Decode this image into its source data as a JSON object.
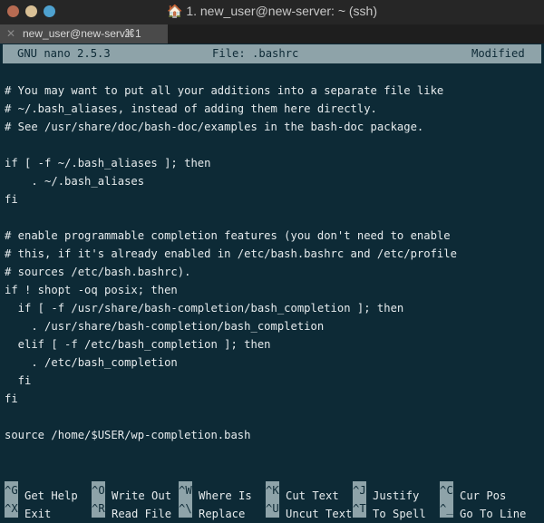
{
  "window": {
    "title": "1. new_user@new-server: ~ (ssh)",
    "icon": "home-icon",
    "traffic_lights": {
      "close": "#b76b52",
      "minimize": "#d9c095",
      "zoom": "#4ea1cf"
    }
  },
  "tab": {
    "label": "new_user@new-serv...",
    "shortcut": "⌘1"
  },
  "nano": {
    "version": "GNU nano 2.5.3",
    "file": "File: .bashrc",
    "status": "Modified"
  },
  "lines": [
    "# You may want to put all your additions into a separate file like",
    "# ~/.bash_aliases, instead of adding them here directly.",
    "# See /usr/share/doc/bash-doc/examples in the bash-doc package.",
    "",
    "if [ -f ~/.bash_aliases ]; then",
    "    . ~/.bash_aliases",
    "fi",
    "",
    "# enable programmable completion features (you don't need to enable",
    "# this, if it's already enabled in /etc/bash.bashrc and /etc/profile",
    "# sources /etc/bash.bashrc).",
    "if ! shopt -oq posix; then",
    "  if [ -f /usr/share/bash-completion/bash_completion ]; then",
    "    . /usr/share/bash-completion/bash_completion",
    "  elif [ -f /etc/bash_completion ]; then",
    "    . /etc/bash_completion",
    "  fi",
    "fi",
    "",
    "source /home/$USER/wp-completion.bash"
  ],
  "shortcuts": [
    [
      {
        "key": "^G",
        "label": "Get Help"
      },
      {
        "key": "^O",
        "label": "Write Out"
      },
      {
        "key": "^W",
        "label": "Where Is"
      },
      {
        "key": "^K",
        "label": "Cut Text"
      },
      {
        "key": "^J",
        "label": "Justify"
      },
      {
        "key": "^C",
        "label": "Cur Pos"
      }
    ],
    [
      {
        "key": "^X",
        "label": "Exit"
      },
      {
        "key": "^R",
        "label": "Read File"
      },
      {
        "key": "^\\",
        "label": "Replace"
      },
      {
        "key": "^U",
        "label": "Uncut Text"
      },
      {
        "key": "^T",
        "label": "To Spell"
      },
      {
        "key": "^_",
        "label": "Go To Line"
      }
    ]
  ]
}
